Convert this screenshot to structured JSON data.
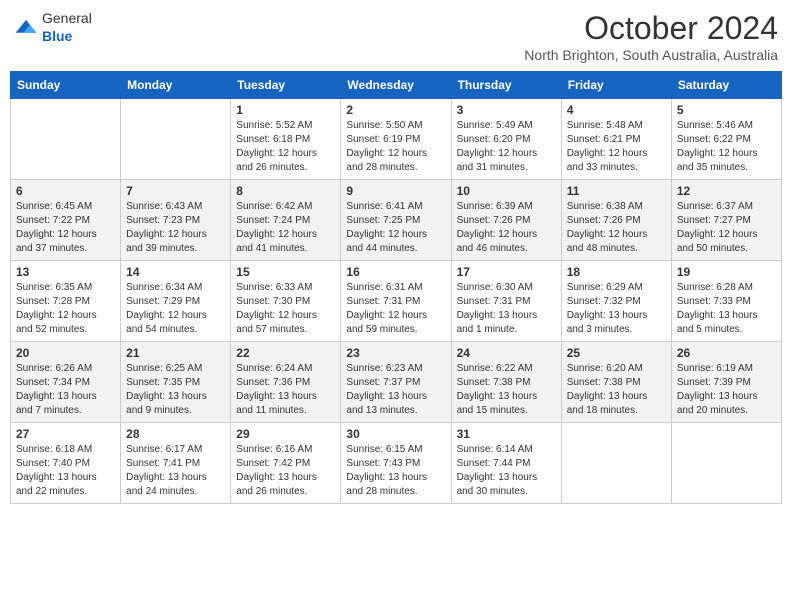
{
  "header": {
    "logo": {
      "general": "General",
      "blue": "Blue"
    },
    "title": "October 2024",
    "subtitle": "North Brighton, South Australia, Australia"
  },
  "days_of_week": [
    "Sunday",
    "Monday",
    "Tuesday",
    "Wednesday",
    "Thursday",
    "Friday",
    "Saturday"
  ],
  "weeks": [
    [
      {
        "day": "",
        "info": ""
      },
      {
        "day": "",
        "info": ""
      },
      {
        "day": "1",
        "info": "Sunrise: 5:52 AM\nSunset: 6:18 PM\nDaylight: 12 hours\nand 26 minutes."
      },
      {
        "day": "2",
        "info": "Sunrise: 5:50 AM\nSunset: 6:19 PM\nDaylight: 12 hours\nand 28 minutes."
      },
      {
        "day": "3",
        "info": "Sunrise: 5:49 AM\nSunset: 6:20 PM\nDaylight: 12 hours\nand 31 minutes."
      },
      {
        "day": "4",
        "info": "Sunrise: 5:48 AM\nSunset: 6:21 PM\nDaylight: 12 hours\nand 33 minutes."
      },
      {
        "day": "5",
        "info": "Sunrise: 5:46 AM\nSunset: 6:22 PM\nDaylight: 12 hours\nand 35 minutes."
      }
    ],
    [
      {
        "day": "6",
        "info": "Sunrise: 6:45 AM\nSunset: 7:22 PM\nDaylight: 12 hours\nand 37 minutes."
      },
      {
        "day": "7",
        "info": "Sunrise: 6:43 AM\nSunset: 7:23 PM\nDaylight: 12 hours\nand 39 minutes."
      },
      {
        "day": "8",
        "info": "Sunrise: 6:42 AM\nSunset: 7:24 PM\nDaylight: 12 hours\nand 41 minutes."
      },
      {
        "day": "9",
        "info": "Sunrise: 6:41 AM\nSunset: 7:25 PM\nDaylight: 12 hours\nand 44 minutes."
      },
      {
        "day": "10",
        "info": "Sunrise: 6:39 AM\nSunset: 7:26 PM\nDaylight: 12 hours\nand 46 minutes."
      },
      {
        "day": "11",
        "info": "Sunrise: 6:38 AM\nSunset: 7:26 PM\nDaylight: 12 hours\nand 48 minutes."
      },
      {
        "day": "12",
        "info": "Sunrise: 6:37 AM\nSunset: 7:27 PM\nDaylight: 12 hours\nand 50 minutes."
      }
    ],
    [
      {
        "day": "13",
        "info": "Sunrise: 6:35 AM\nSunset: 7:28 PM\nDaylight: 12 hours\nand 52 minutes."
      },
      {
        "day": "14",
        "info": "Sunrise: 6:34 AM\nSunset: 7:29 PM\nDaylight: 12 hours\nand 54 minutes."
      },
      {
        "day": "15",
        "info": "Sunrise: 6:33 AM\nSunset: 7:30 PM\nDaylight: 12 hours\nand 57 minutes."
      },
      {
        "day": "16",
        "info": "Sunrise: 6:31 AM\nSunset: 7:31 PM\nDaylight: 12 hours\nand 59 minutes."
      },
      {
        "day": "17",
        "info": "Sunrise: 6:30 AM\nSunset: 7:31 PM\nDaylight: 13 hours\nand 1 minute."
      },
      {
        "day": "18",
        "info": "Sunrise: 6:29 AM\nSunset: 7:32 PM\nDaylight: 13 hours\nand 3 minutes."
      },
      {
        "day": "19",
        "info": "Sunrise: 6:28 AM\nSunset: 7:33 PM\nDaylight: 13 hours\nand 5 minutes."
      }
    ],
    [
      {
        "day": "20",
        "info": "Sunrise: 6:26 AM\nSunset: 7:34 PM\nDaylight: 13 hours\nand 7 minutes."
      },
      {
        "day": "21",
        "info": "Sunrise: 6:25 AM\nSunset: 7:35 PM\nDaylight: 13 hours\nand 9 minutes."
      },
      {
        "day": "22",
        "info": "Sunrise: 6:24 AM\nSunset: 7:36 PM\nDaylight: 13 hours\nand 11 minutes."
      },
      {
        "day": "23",
        "info": "Sunrise: 6:23 AM\nSunset: 7:37 PM\nDaylight: 13 hours\nand 13 minutes."
      },
      {
        "day": "24",
        "info": "Sunrise: 6:22 AM\nSunset: 7:38 PM\nDaylight: 13 hours\nand 15 minutes."
      },
      {
        "day": "25",
        "info": "Sunrise: 6:20 AM\nSunset: 7:38 PM\nDaylight: 13 hours\nand 18 minutes."
      },
      {
        "day": "26",
        "info": "Sunrise: 6:19 AM\nSunset: 7:39 PM\nDaylight: 13 hours\nand 20 minutes."
      }
    ],
    [
      {
        "day": "27",
        "info": "Sunrise: 6:18 AM\nSunset: 7:40 PM\nDaylight: 13 hours\nand 22 minutes."
      },
      {
        "day": "28",
        "info": "Sunrise: 6:17 AM\nSunset: 7:41 PM\nDaylight: 13 hours\nand 24 minutes."
      },
      {
        "day": "29",
        "info": "Sunrise: 6:16 AM\nSunset: 7:42 PM\nDaylight: 13 hours\nand 26 minutes."
      },
      {
        "day": "30",
        "info": "Sunrise: 6:15 AM\nSunset: 7:43 PM\nDaylight: 13 hours\nand 28 minutes."
      },
      {
        "day": "31",
        "info": "Sunrise: 6:14 AM\nSunset: 7:44 PM\nDaylight: 13 hours\nand 30 minutes."
      },
      {
        "day": "",
        "info": ""
      },
      {
        "day": "",
        "info": ""
      }
    ]
  ]
}
